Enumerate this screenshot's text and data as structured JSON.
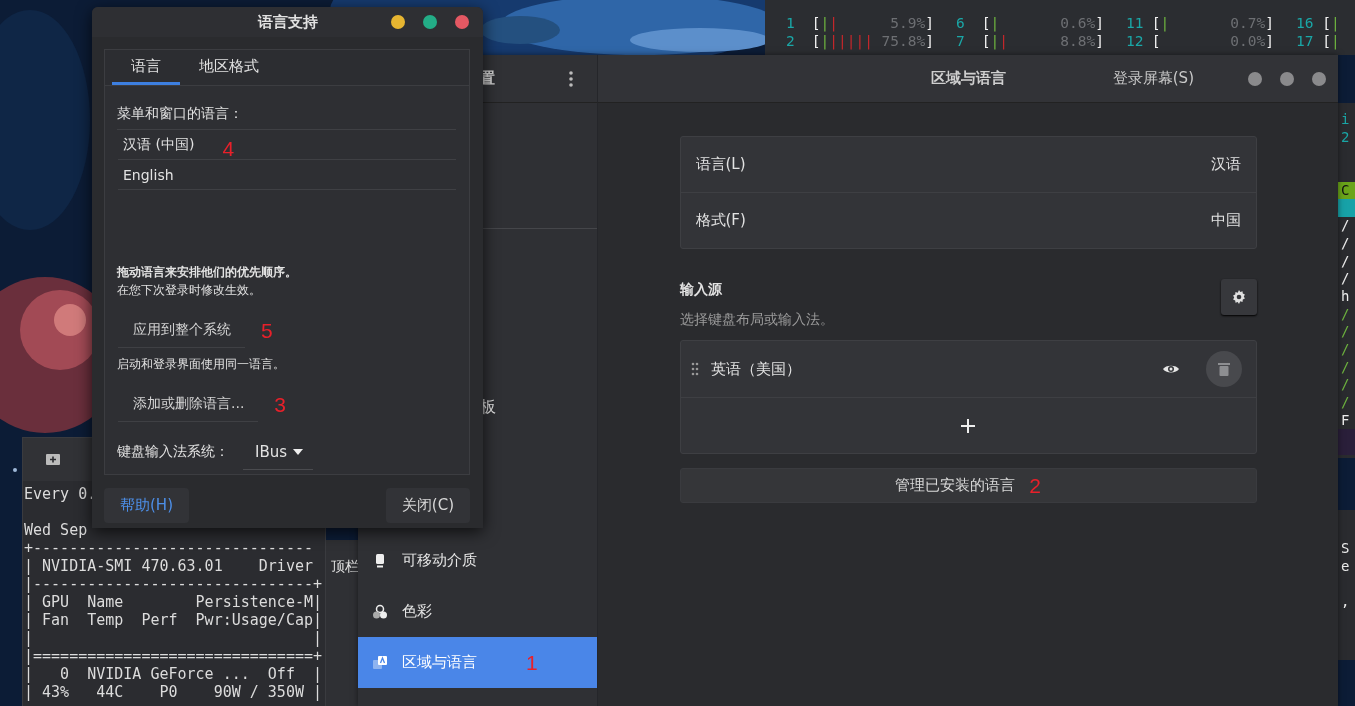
{
  "htop": {
    "bracket_open": "[",
    "bracket_close": "]",
    "rows": [
      [
        {
          "cpu": "1",
          "bar": "||",
          "reading": "5.9%"
        },
        {
          "cpu": "6",
          "bar": "|",
          "reading": "0.6%"
        },
        {
          "cpu": "11",
          "bar": "|",
          "reading": "0.7%"
        },
        {
          "cpu": "16",
          "bar": "|"
        }
      ],
      [
        {
          "cpu": "2",
          "bar": "||||||",
          "reading": "75.8%"
        },
        {
          "cpu": "7",
          "bar": "||",
          "reading": "8.8%"
        },
        {
          "cpu": "12",
          "reading": "0.0%"
        },
        {
          "cpu": "17",
          "bar": "|"
        }
      ]
    ]
  },
  "right_terminal_upper": [
    {
      "kind": "teal",
      "text": "i"
    },
    {
      "kind": "teal",
      "text": "2"
    },
    {
      "kind": "blank"
    },
    {
      "kind": "blank"
    },
    {
      "kind": "green-bar",
      "text": "C"
    },
    {
      "kind": "teal-bar"
    },
    {
      "kind": "white",
      "text": "/"
    },
    {
      "kind": "white",
      "text": "/"
    },
    {
      "kind": "white",
      "text": "/"
    },
    {
      "kind": "white",
      "text": "/"
    },
    {
      "kind": "white",
      "text": "h"
    },
    {
      "kind": "green",
      "text": "/"
    },
    {
      "kind": "green",
      "text": "/"
    },
    {
      "kind": "green",
      "text": "/"
    },
    {
      "kind": "green",
      "text": "/"
    },
    {
      "kind": "green",
      "text": "/"
    },
    {
      "kind": "green",
      "text": "/"
    },
    {
      "kind": "white",
      "text": "F"
    },
    {
      "kind": "purple-bar"
    }
  ],
  "right_terminal_lower": [
    {
      "kind": "white",
      "text": "S"
    },
    {
      "kind": "white",
      "text": "e"
    },
    {
      "kind": "blank"
    },
    {
      "kind": "white",
      "text": ","
    }
  ],
  "terminal": {
    "header": "Every 0.",
    "lines": [
      "Wed Sep",
      "+-------------------------------",
      "| NVIDIA-SMI 470.63.01    Driver",
      "|-------------------------------+",
      "| GPU  Name        Persistence-M|",
      "| Fan  Temp  Perf  Pwr:Usage/Cap|",
      "|                               |",
      "|===============================+",
      "|   0  NVIDIA GeForce ...  Off  |",
      "| 43%   44C    P0    90W / 350W |"
    ]
  },
  "background_window_label": "顶栏",
  "settings": {
    "sidebar_title": "置",
    "sidebar_partial_label": "板",
    "sidebar": [
      {
        "label": "可移动介质",
        "kind": "removable",
        "selected": false
      },
      {
        "label": "色彩",
        "kind": "color",
        "selected": false
      },
      {
        "label": "区域与语言",
        "kind": "region",
        "selected": true,
        "annotation": "1"
      }
    ],
    "title": "区域与语言",
    "login_screen_button": "登录屏幕(S)",
    "language_rows": [
      {
        "label": "语言(L)",
        "value": "汉语"
      },
      {
        "label": "格式(F)",
        "value": "中国"
      }
    ],
    "input_sources": {
      "title": "输入源",
      "subtitle": "选择键盘布局或输入法。",
      "sources": [
        {
          "label": "英语（美国）"
        }
      ]
    },
    "manage_button": {
      "label": "管理已安装的语言",
      "annotation": "2"
    }
  },
  "dialog": {
    "title": "语言支持",
    "tabs": [
      {
        "label": "语言",
        "selected": true
      },
      {
        "label": "地区格式",
        "selected": false
      }
    ],
    "list_label": "菜单和窗口的语言：",
    "languages": [
      {
        "label": "汉语 (中国)",
        "annotation": "4"
      },
      {
        "label": "English"
      }
    ],
    "hint_bold": "拖动语言来安排他们的优先顺序。",
    "hint": "在您下次登录时修改生效。",
    "apply_button": {
      "label": "应用到整个系统",
      "annotation": "5"
    },
    "apply_hint": "启动和登录界面使用同一语言。",
    "add_button": {
      "label": "添加或删除语言...",
      "annotation": "3"
    },
    "im_label": "键盘输入法系统：",
    "im_value": "IBus",
    "help_button": "帮助(H)",
    "close_button": "关闭(C)"
  }
}
